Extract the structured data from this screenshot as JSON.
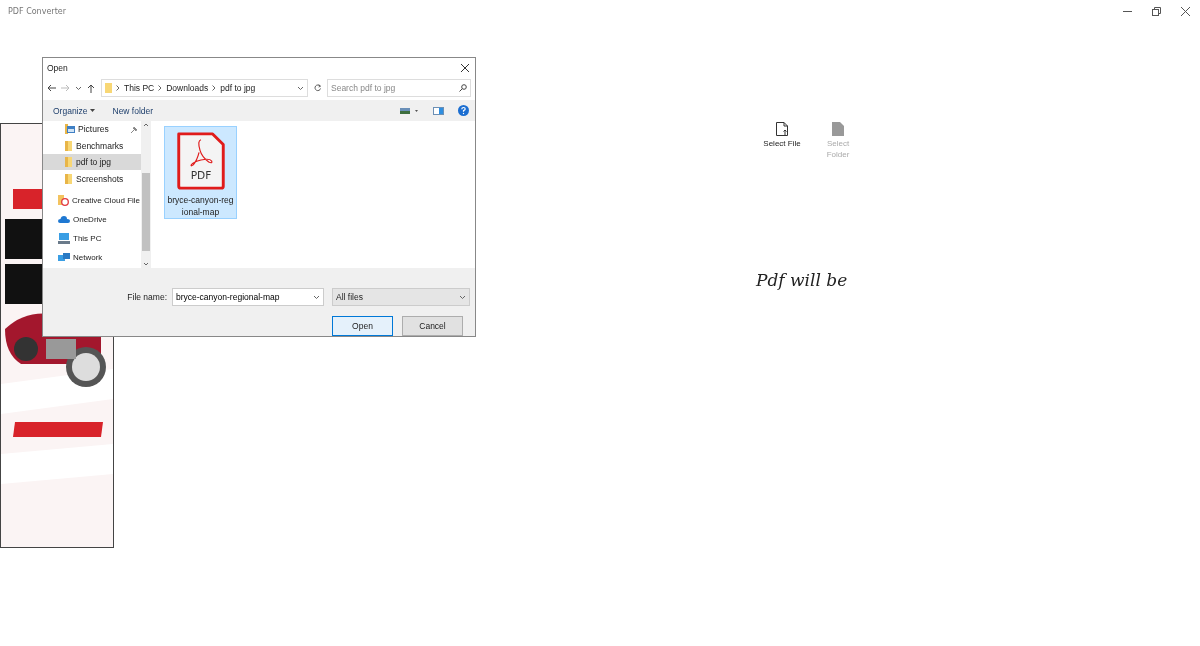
{
  "window": {
    "title": "PDF Converter"
  },
  "actions": [
    {
      "label": "Select File",
      "disabled": false
    },
    {
      "label": "Select Folder",
      "disabled": true
    }
  ],
  "status_text": "Pdf will be",
  "dialog": {
    "title": "Open",
    "breadcrumbs": [
      "This PC",
      "Downloads",
      "pdf to jpg"
    ],
    "search": {
      "placeholder": "Search pdf to jpg"
    },
    "toolbar": {
      "organize": "Organize",
      "new_folder": "New folder"
    },
    "quick_access": [
      {
        "label": "Pictures",
        "kind": "pictures",
        "pinned": true,
        "selected": false
      },
      {
        "label": "Benchmarks",
        "kind": "folder",
        "pinned": false,
        "selected": false
      },
      {
        "label": "pdf to jpg",
        "kind": "folder",
        "pinned": false,
        "selected": true
      },
      {
        "label": "Screenshots",
        "kind": "folder",
        "pinned": false,
        "selected": false
      }
    ],
    "locations": [
      {
        "label": "Creative Cloud File",
        "kind": "creative-cloud",
        "selected": false
      },
      {
        "label": "OneDrive",
        "kind": "cloud",
        "selected": false
      },
      {
        "label": "This PC",
        "kind": "pc",
        "selected": false
      },
      {
        "label": "Network",
        "kind": "network",
        "selected": false
      }
    ],
    "files": [
      {
        "name": "bryce-canyon-regional-map",
        "type_label": "PDF",
        "selected": true
      }
    ],
    "file_name_label": "File name:",
    "file_name": "bryce-canyon-regional-map",
    "filter": "All files",
    "buttons": [
      {
        "label": "Open",
        "kind": "default"
      },
      {
        "label": "Cancel",
        "kind": "normal"
      }
    ]
  }
}
